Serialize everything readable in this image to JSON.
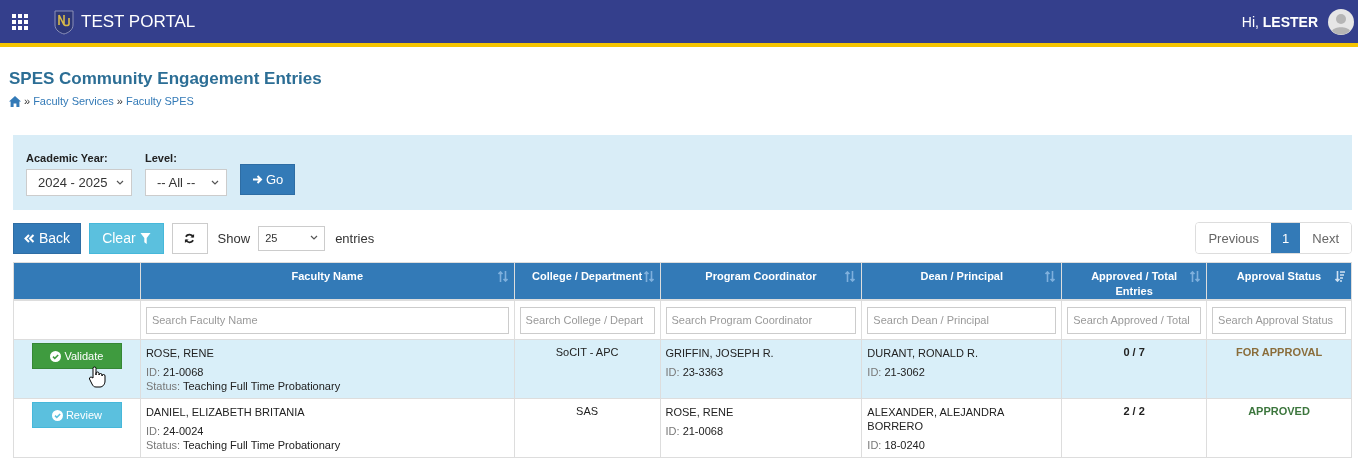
{
  "navbar": {
    "brand": "TEST PORTAL",
    "greeting": "Hi,",
    "user": "LESTER"
  },
  "page": {
    "title": "SPES Community Engagement Entries",
    "breadcrumb": [
      "Faculty Services",
      "Faculty SPES"
    ],
    "separator": "»"
  },
  "filters": [
    {
      "label": "Academic Year:",
      "value": "2024 - 2025",
      "kind": "wide"
    },
    {
      "label": "Level:",
      "value": "-- All --",
      "kind": "narrow"
    }
  ],
  "go_button": "Go",
  "toolbar": {
    "back": "Back",
    "clear": "Clear",
    "show_label": "Show",
    "page_size": "25",
    "entries_label": "entries"
  },
  "pagination": [
    {
      "label": "Previous",
      "selected": false
    },
    {
      "label": "1",
      "selected": true
    },
    {
      "label": "Next",
      "selected": false
    }
  ],
  "table": {
    "columns": [
      {
        "label": "Faculty Name",
        "sorted": false,
        "placeholder": "Search Faculty Name"
      },
      {
        "label": "College / Department",
        "sorted": false,
        "placeholder": "Search College / Depart"
      },
      {
        "label": "Program Coordinator",
        "sorted": false,
        "placeholder": "Search Program Coordinator"
      },
      {
        "label": "Dean / Principal",
        "sorted": false,
        "placeholder": "Search Dean / Principal"
      },
      {
        "label": "Approved / Total Entries",
        "sorted": false,
        "placeholder": "Search Approved / Total"
      },
      {
        "label": "Approval Status",
        "sorted": true,
        "placeholder": "Search Approval Status"
      }
    ],
    "rows": [
      {
        "highlighted": true,
        "action": {
          "label": "Validate",
          "kind": "validate",
          "pointer": true
        },
        "faculty": {
          "name": "ROSE, RENE",
          "id_label": "ID:",
          "id": "21-0068",
          "status_label": "Status:",
          "status": "Teaching Full Time Probationary"
        },
        "college": "SoCIT - APC",
        "coordinator": {
          "name": "GRIFFIN, JOSEPH R.",
          "id_label": "ID:",
          "id": "23-3363"
        },
        "dean": {
          "name": "DURANT, RONALD R.",
          "id_label": "ID:",
          "id": "21-3062"
        },
        "approved_total": "0 / 7",
        "approval_status": {
          "label": "FOR APPROVAL",
          "kind": "pending"
        }
      },
      {
        "highlighted": false,
        "action": {
          "label": "Review",
          "kind": "review",
          "pointer": false
        },
        "faculty": {
          "name": "DANIEL, ELIZABETH BRITANIA",
          "id_label": "ID:",
          "id": "24-0024",
          "status_label": "Status:",
          "status": "Teaching Full Time Probationary"
        },
        "college": "SAS",
        "coordinator": {
          "name": "ROSE, RENE",
          "id_label": "ID:",
          "id": "21-0068"
        },
        "dean": {
          "name": "ALEXANDER, ALEJANDRA BORRERO",
          "id_label": "ID:",
          "id": "18-0240"
        },
        "approved_total": "2 / 2",
        "approval_status": {
          "label": "APPROVED",
          "kind": "approved"
        }
      }
    ]
  }
}
